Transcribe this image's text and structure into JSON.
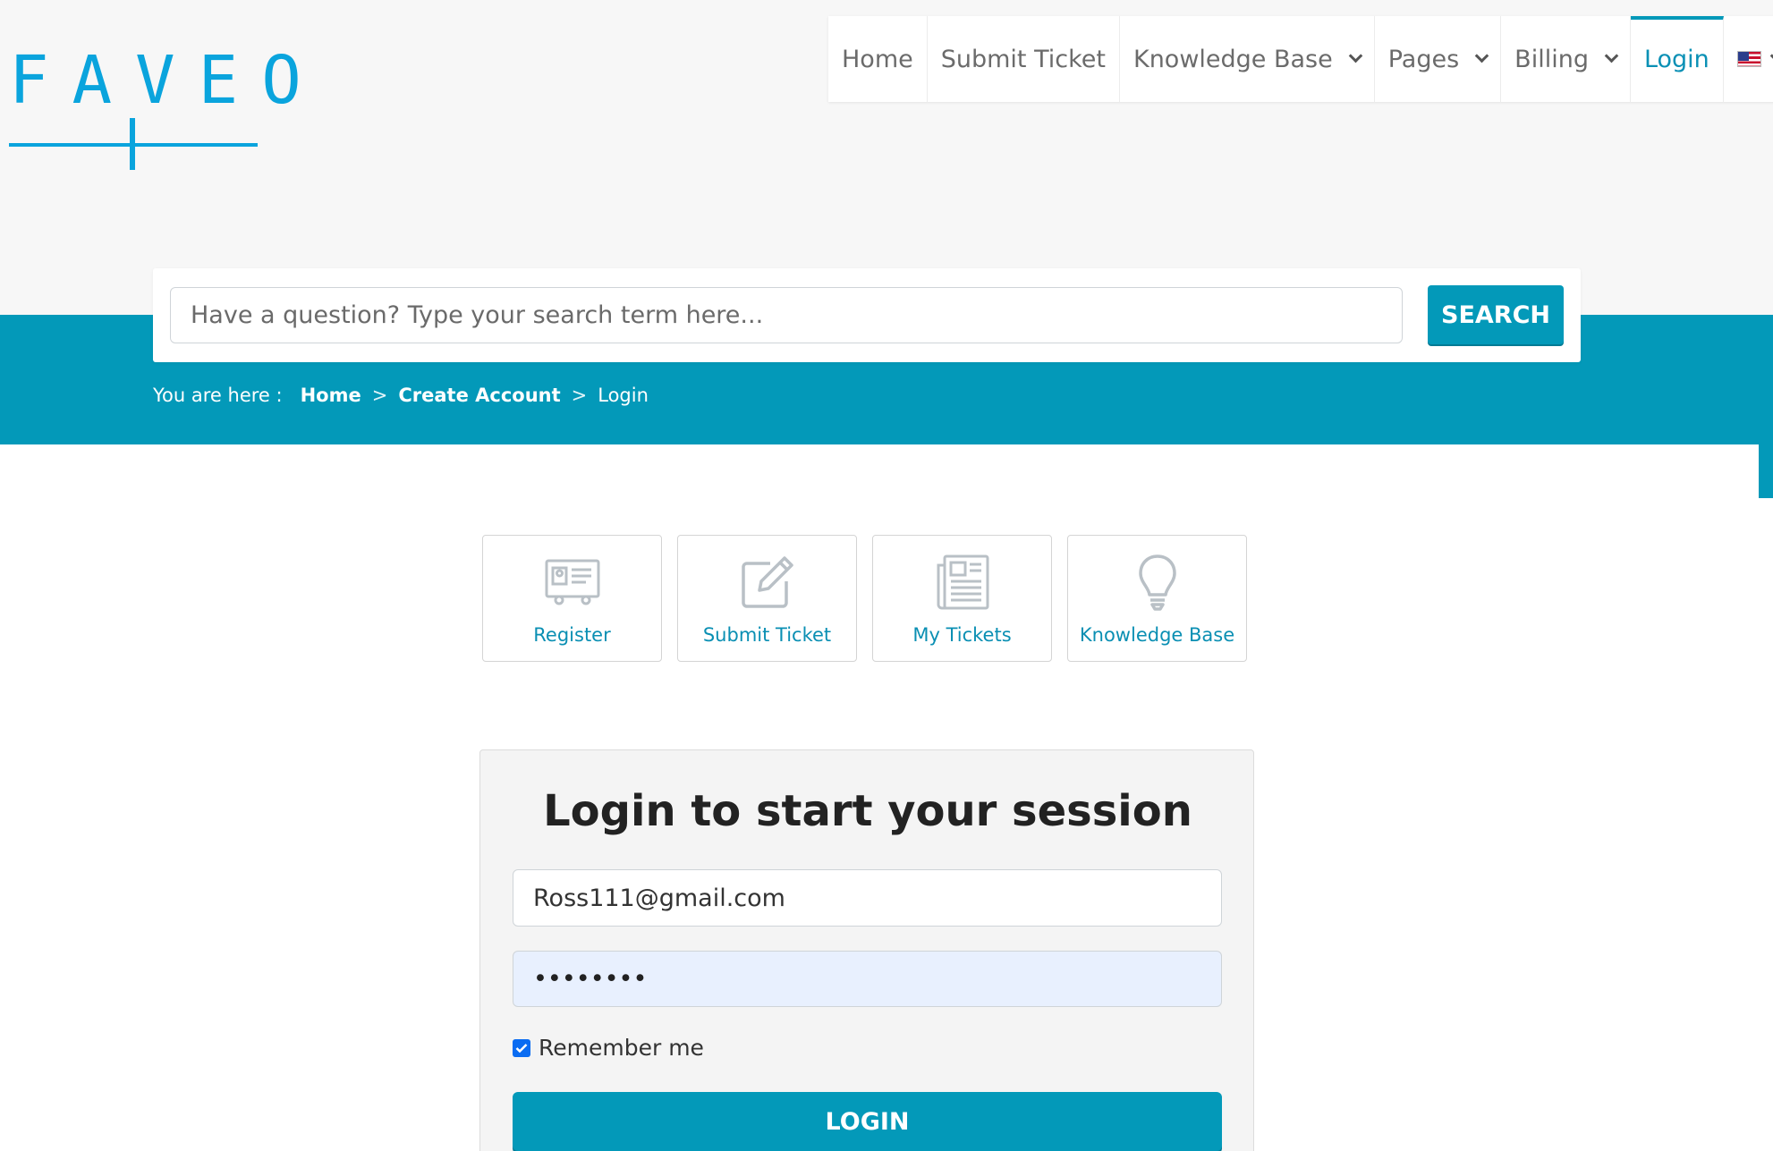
{
  "logo": {
    "text": "FAVEO"
  },
  "nav": {
    "items": [
      {
        "label": "Home"
      },
      {
        "label": "Submit Ticket"
      },
      {
        "label": "Knowledge Base"
      },
      {
        "label": "Pages"
      },
      {
        "label": "Billing"
      },
      {
        "label": "Login"
      }
    ],
    "language_flag": "us-flag-icon"
  },
  "search": {
    "placeholder": "Have a question? Type your search term here...",
    "button_label": "SEARCH"
  },
  "breadcrumb": {
    "prefix": "You are here :",
    "items": [
      "Home",
      "Create Account",
      "Login"
    ],
    "separator": ">"
  },
  "tiles": [
    {
      "label": "Register",
      "icon": "id-card-icon"
    },
    {
      "label": "Submit Ticket",
      "icon": "edit-icon"
    },
    {
      "label": "My Tickets",
      "icon": "newspaper-icon"
    },
    {
      "label": "Knowledge Base",
      "icon": "lightbulb-icon"
    }
  ],
  "login": {
    "title": "Login to start your session",
    "email_value": "Ross111@gmail.com",
    "password_value": "••••••••",
    "remember_label": "Remember me",
    "remember_checked": true,
    "button_label": "LOGIN"
  },
  "colors": {
    "brand": "#0399b9",
    "logo": "#0aa4dd",
    "link": "#0a8fb3",
    "autofill_bg": "#e8f0fe"
  }
}
